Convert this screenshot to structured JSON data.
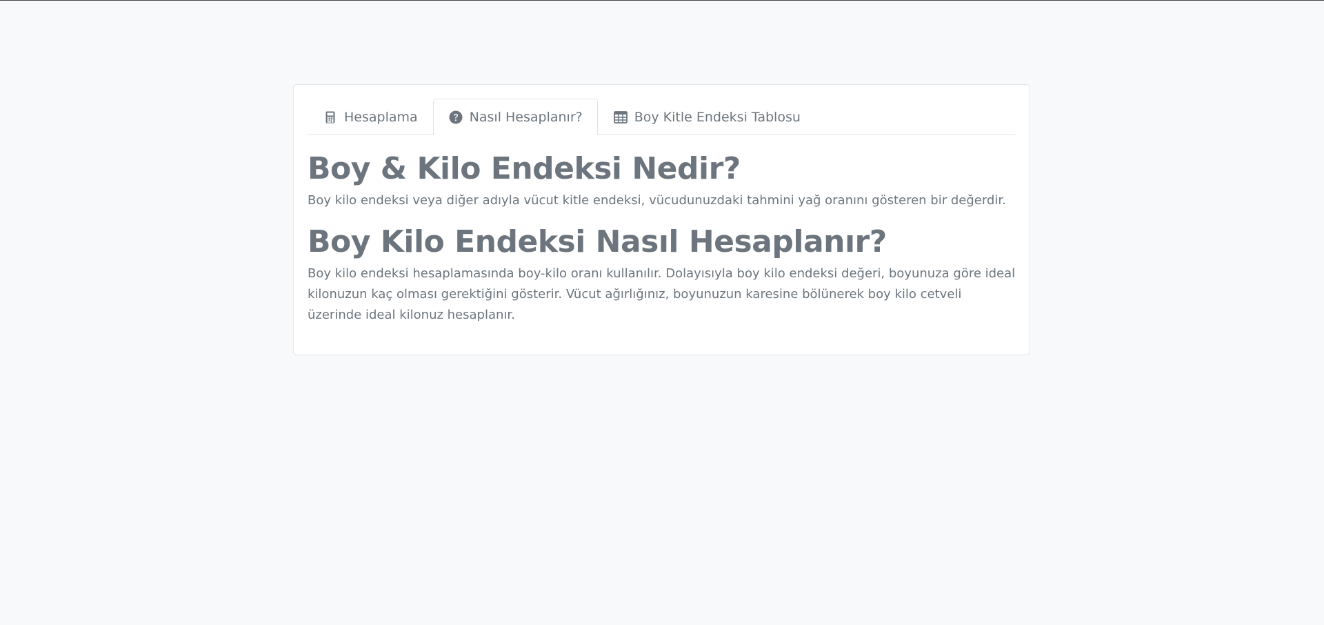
{
  "tabs": [
    {
      "label": "Hesaplama",
      "icon": "calculator-icon"
    },
    {
      "label": "Nasıl Hesaplanır?",
      "icon": "question-circle-icon",
      "active": true
    },
    {
      "label": "Boy Kitle Endeksi Tablosu",
      "icon": "table-icon"
    }
  ],
  "content": {
    "heading1": "Boy & Kilo Endeksi Nedir?",
    "paragraph1": "Boy kilo endeksi veya diğer adıyla vücut kitle endeksi, vücudunuzdaki tahmini yağ oranını gösteren bir değerdir.",
    "heading2": "Boy Kilo Endeksi Nasıl Hesaplanır?",
    "paragraph2": "Boy kilo endeksi hesaplamasında boy-kilo oranı kullanılır. Dolayısıyla boy kilo endeksi değeri, boyunuza göre ideal kilonuzun kaç olması gerektiğini gösterir. Vücut ağırlığınız, boyunuzun karesine bölünerek boy kilo cetveli üzerinde ideal kilonuz hesaplanır."
  },
  "colors": {
    "background": "#f8f9fa",
    "text": "#6c757d",
    "border": "#dee2e6"
  }
}
